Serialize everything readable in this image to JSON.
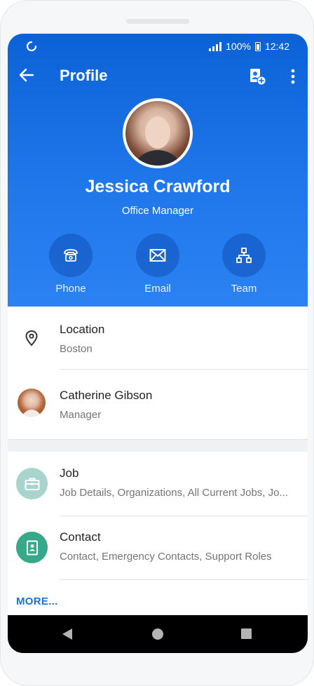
{
  "status_bar": {
    "battery": "100%",
    "time": "12:42"
  },
  "app_bar": {
    "title": "Profile"
  },
  "profile": {
    "name": "Jessica Crawford",
    "role": "Office Manager"
  },
  "actions": [
    {
      "label": "Phone",
      "icon": "phone-icon"
    },
    {
      "label": "Email",
      "icon": "email-icon"
    },
    {
      "label": "Team",
      "icon": "team-icon"
    }
  ],
  "details": {
    "location": {
      "title": "Location",
      "value": "Boston"
    },
    "manager": {
      "name": "Catherine Gibson",
      "title": "Manager"
    }
  },
  "sections": [
    {
      "title": "Job",
      "subtitle": "Job Details, Organizations, All Current Jobs, Jo...",
      "icon": "briefcase-icon",
      "color": "#a9d4cd"
    },
    {
      "title": "Contact",
      "subtitle": "Contact, Emergency Contacts, Support Roles",
      "icon": "contact-card-icon",
      "color": "#37a98b"
    }
  ],
  "more_label": "MORE...",
  "colors": {
    "header_blue": "#1f77ea",
    "link_blue": "#1a73d6"
  }
}
